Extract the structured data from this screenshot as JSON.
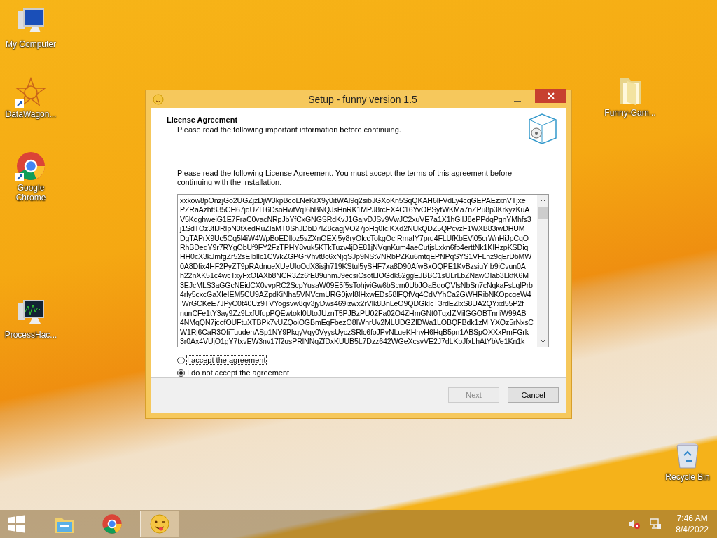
{
  "desktop_icons": [
    {
      "label": "My Computer",
      "kind": "computer"
    },
    {
      "label": "DataWagon...",
      "kind": "star"
    },
    {
      "label": "Google Chrome",
      "kind": "chrome"
    },
    {
      "label": "ProcessHac...",
      "kind": "monitor"
    },
    {
      "label": "Funny-Gam...",
      "kind": "folder"
    },
    {
      "label": "Recycle Bin",
      "kind": "bin"
    }
  ],
  "window": {
    "title": "Setup - funny version 1.5",
    "header": {
      "title": "License Agreement",
      "subtitle": "Please read the following important information before continuing."
    },
    "intro": "Please read the following License Agreement. You must accept the terms of this agreement before continuing with the installation.",
    "license_lines": [
      "xxkow8pOnzjGo2UGZjzDjW3kpBcoLNeKrX9y0itWAI9q2sibJGXoKn5SqQKAH6lFVdLy4cqGEPAEzxnVTjxe",
      "PZRaAzht835CH67jqUZlT6DsoHwfVqI6hBNQJsHnRK1MPJ8rcEX4C16YvOPSyfWKMa7nZPu8p3KrkyzKuA",
      "V5KqghweiG1E7FraC0vacNRpJbYfCxGNGSRdKvJ1GajvDJSv9VwJC2xuVE7a1X1hGiIJ8ePPdqPgnYMhfs3",
      "j1SdTOz3fIJRIpN3tXedRuZIaMT0ShJDbD7lZ8cagjVO27joHq0IciKXd2NUkQDZ5QPcvzF1WXB83iwDHUM",
      "DgTAPrX9Uc5Cq5l4iW4WpBoEDlloz5sZXnOEXj5y8ryOlccTokgOcIRmaIY7pru4FLUfKbEVi05crWnHiJpCqO",
      "RhBDedY9r7RYgObUf9FY2FzTPHY8vuk5KTkTuzv4jDE81jNVqnKum4aeCutjsLxkn6fb4erttNk1KIHzpKSDiq",
      "HH0cX3kJmfgZr52sEIbIlc1CWkZGPGrVhvt8c6xNjqSJp9NStVNRbPZKu6mtqEPNPqSYS1VFLnz9qErDbMW",
      "0A8Dfix4HF2PyZT9pRAdnueXUeUloOdX8isjh719KStul5ySHF7xa8D90AfwBxOQPE1KvBzsiuYIb9iCvun0A",
      "h22nXK51c4wcTxyFxOIAXb8NCR3Zz6fE89uhmJ9ecsiCsotLlOGdk62ggEJBBC1sULrLbZNawOIab3LkfK6M",
      "3EJcMLS3aGGcNEidCX0vvpRC2ScpYusaW09E5f5sTohjviGw6bScm0UbJOaBqoQVlsNbSn7cNqkaFsLqlPrb",
      "4rly5cxcGaXIeIEM5CU9AZpdKiNha5VNVcmURG0jwI8IHxwEDs58lFQfVq4CdVYhCa2GWHRibNKOpcgeW4",
      "IWrGCKeE7JPyC0t40Uz9TVYogsvw8qv3jyDws469izwx2rVlk8BnLeO9QDGkIcT3rdEZlxS8UA2QYxd55P2f",
      "nunCFe1tY3ay9Zz9LxfUfupPQEwtokI0UtoJUznT5PJBzPU02Fa02O4ZHmGNt0TqxIZMilGGOBTnrliW99AB",
      "4NMqQN7jcofOUFtuXTBPk7vUZQoiOGBmEqFbezO8IWnrUv2MLUDGZlDWa1LOBQFBdk1zMIYXQz5rNxsC",
      "W1Rj6CaR3OfiTuudenASp1NY9PkqyVqy0VyysUyczSRlc6foJPvNLueKHhyH6HqB5pn1ABSpOXXxPmFGrk",
      "3r0Ax4VUjO1gY7txvEW3nv17f2usPRlNNqZfDxKUUB5L7Dzz642WGeXcsvVE2J7dLKbJfxLhAtYbVe1Kn1k"
    ],
    "options": [
      {
        "label": "I accept the agreement",
        "selected": false
      },
      {
        "label": "I do not accept the agreement",
        "selected": true
      }
    ],
    "buttons": [
      {
        "label": "Next",
        "disabled": true
      },
      {
        "label": "Cancel",
        "disabled": false
      }
    ]
  },
  "taskbar": {
    "apps": [
      {
        "kind": "explorer",
        "active": false
      },
      {
        "kind": "chrome",
        "active": false
      },
      {
        "kind": "smiley",
        "active": true
      }
    ],
    "time": "7:46 AM",
    "date": "8/4/2022"
  }
}
